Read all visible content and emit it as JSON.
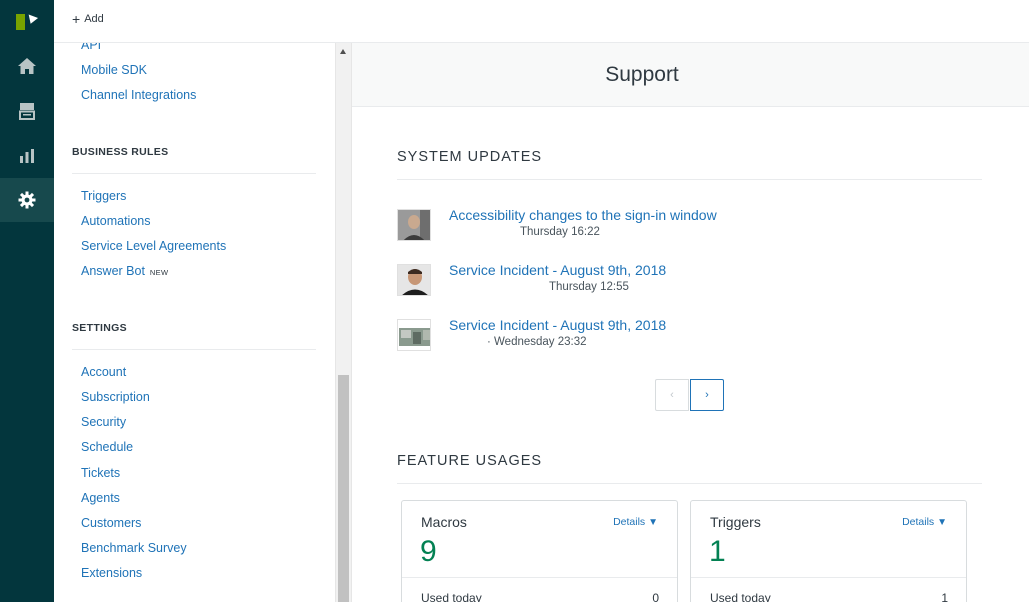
{
  "topbar": {
    "add_label": "Add"
  },
  "sidebar": {
    "top_links": [
      "API",
      "Mobile SDK",
      "Channel Integrations"
    ],
    "business_rules": {
      "heading": "BUSINESS RULES",
      "items": [
        "Triggers",
        "Automations",
        "Service Level Agreements",
        "Answer Bot"
      ],
      "new_badge": "NEW"
    },
    "settings": {
      "heading": "SETTINGS",
      "items": [
        "Account",
        "Subscription",
        "Security",
        "Schedule",
        "Tickets",
        "Agents",
        "Customers",
        "Benchmark Survey",
        "Extensions"
      ]
    }
  },
  "main": {
    "page_title": "Support",
    "system_updates": {
      "heading": "SYSTEM UPDATES",
      "items": [
        {
          "title": "Accessibility changes to the sign-in window",
          "time": "Thursday 16:22"
        },
        {
          "title": "Service Incident - August 9th, 2018",
          "time": "Thursday 12:55"
        },
        {
          "title": "Service Incident - August 9th, 2018",
          "time": "· Wednesday 23:32"
        }
      ],
      "pager": {
        "prev": "‹",
        "next": "›"
      }
    },
    "feature_usages": {
      "heading": "FEATURE USAGES",
      "cards": [
        {
          "name": "Macros",
          "details": "Details",
          "count": "9",
          "used_label": "Used today",
          "used_value": "0"
        },
        {
          "name": "Triggers",
          "details": "Details",
          "count": "1",
          "used_label": "Used today",
          "used_value": "1"
        }
      ]
    }
  },
  "colors": {
    "rail": "#03363d",
    "rail_active": "#17494d",
    "link": "#1f73b7",
    "count": "#038153"
  },
  "icons": [
    "zendesk-logo-icon",
    "home-icon",
    "views-icon",
    "reporting-icon",
    "gear-icon"
  ]
}
